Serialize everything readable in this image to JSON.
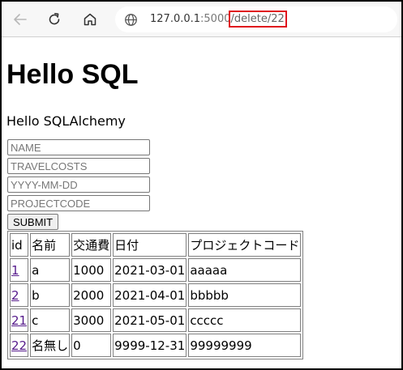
{
  "browser": {
    "url_host": "127.0.0.1",
    "url_port": ":5000",
    "url_path": "/delete/22",
    "highlight_color": "#e0141e",
    "icons": [
      "back-arrow-icon",
      "reload-icon",
      "home-icon",
      "globe-icon"
    ]
  },
  "page": {
    "title": "Hello SQL",
    "subtitle": "Hello SQLAlchemy",
    "form": {
      "name_placeholder": "NAME",
      "travelcosts_placeholder": "TRAVELCOSTS",
      "date_placeholder": "YYYY-MM-DD",
      "projectcode_placeholder": "PROJECTCODE",
      "submit_label": "SUBMIT"
    },
    "table": {
      "headers": [
        "id",
        "名前",
        "交通費",
        "日付",
        "プロジェクトコード"
      ],
      "rows": [
        [
          "1",
          "a",
          "1000",
          "2021-03-01",
          "aaaaa"
        ],
        [
          "2",
          "b",
          "2000",
          "2021-04-01",
          "bbbbb"
        ],
        [
          "21",
          "c",
          "3000",
          "2021-05-01",
          "ccccc"
        ],
        [
          "22",
          "名無し",
          "0",
          "9999-12-31",
          "99999999"
        ]
      ]
    }
  }
}
